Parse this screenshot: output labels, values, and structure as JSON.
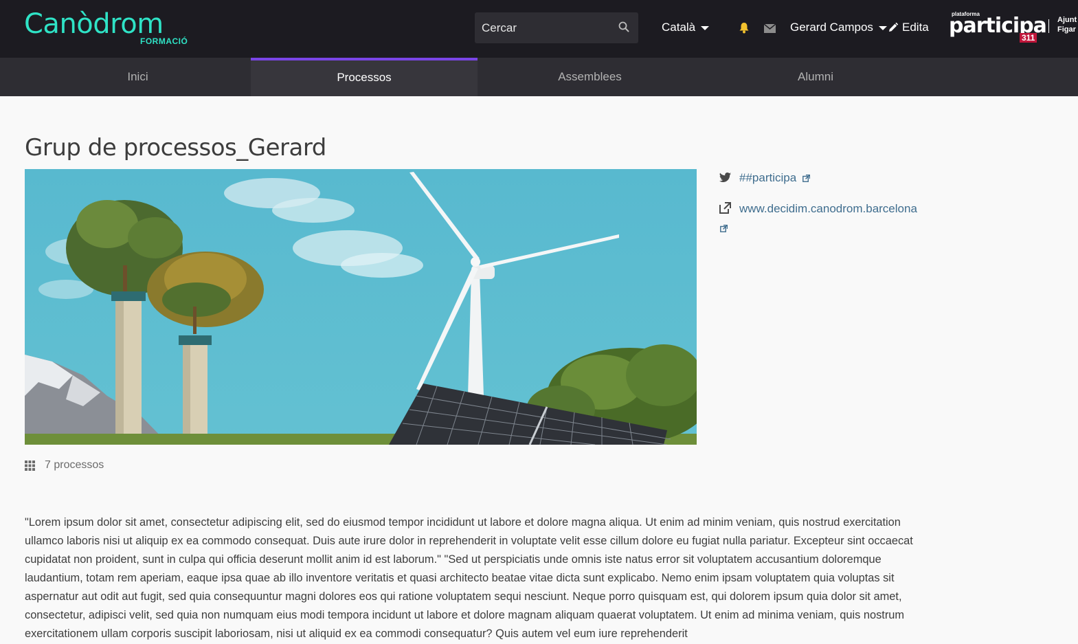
{
  "header": {
    "logo_main": "Canòdrom",
    "logo_sub": "FORMACIÓ",
    "search_placeholder": "Cercar",
    "language": "Català",
    "user_name": "Gerard Campos",
    "edit_label": "Edita",
    "participa_small": "plataforma",
    "participa_main": "participa",
    "participa_num": "311",
    "ajuntament_line1": "Ajunt",
    "ajuntament_line2": "Figar"
  },
  "nav": {
    "items": [
      {
        "label": "Inici"
      },
      {
        "label": "Processos"
      },
      {
        "label": "Assemblees"
      },
      {
        "label": "Alumni"
      }
    ],
    "active": "Processos"
  },
  "main": {
    "title": "Grup de processos_Gerard",
    "process_count": "7 processos",
    "description": "\"Lorem ipsum dolor sit amet, consectetur adipiscing elit, sed do eiusmod tempor incididunt ut labore et dolore magna aliqua. Ut enim ad minim veniam, quis nostrud exercitation ullamco laboris nisi ut aliquip ex ea commodo consequat. Duis aute irure dolor in reprehenderit in voluptate velit esse cillum dolore eu fugiat nulla pariatur. Excepteur sint occaecat cupidatat non proident, sunt in culpa qui officia deserunt mollit anim id est laborum.\" \"Sed ut perspiciatis unde omnis iste natus error sit voluptatem accusantium doloremque laudantium, totam rem aperiam, eaque ipsa quae ab illo inventore veritatis et quasi architecto beatae vitae dicta sunt explicabo. Nemo enim ipsam voluptatem quia voluptas sit aspernatur aut odit aut fugit, sed quia consequuntur magni dolores eos qui ratione voluptatem sequi nesciunt. Neque porro quisquam est, qui dolorem ipsum quia dolor sit amet, consectetur, adipisci velit, sed quia non numquam eius modi tempora incidunt ut labore et dolore magnam aliquam quaerat voluptatem. Ut enim ad minima veniam, quis nostrum exercitationem ullam corporis suscipit laboriosam, nisi ut aliquid ex ea commodi consequatur? Quis autem vel eum iure reprehenderit"
  },
  "sidebar": {
    "hashtag": "##participa",
    "website": "www.decidim.canodrom.barcelona"
  },
  "colors": {
    "topbar": "#1c1b21",
    "nav": "#2e2d33",
    "accent": "#7a45e6",
    "logo": "#2fe3c6",
    "link": "#3f6d8e",
    "bell": "#f2c12e"
  },
  "icons": [
    "search-icon",
    "caret-down-icon",
    "bell-icon",
    "mail-icon",
    "pencil-icon",
    "twitter-icon",
    "external-link-icon",
    "grid-icon"
  ]
}
